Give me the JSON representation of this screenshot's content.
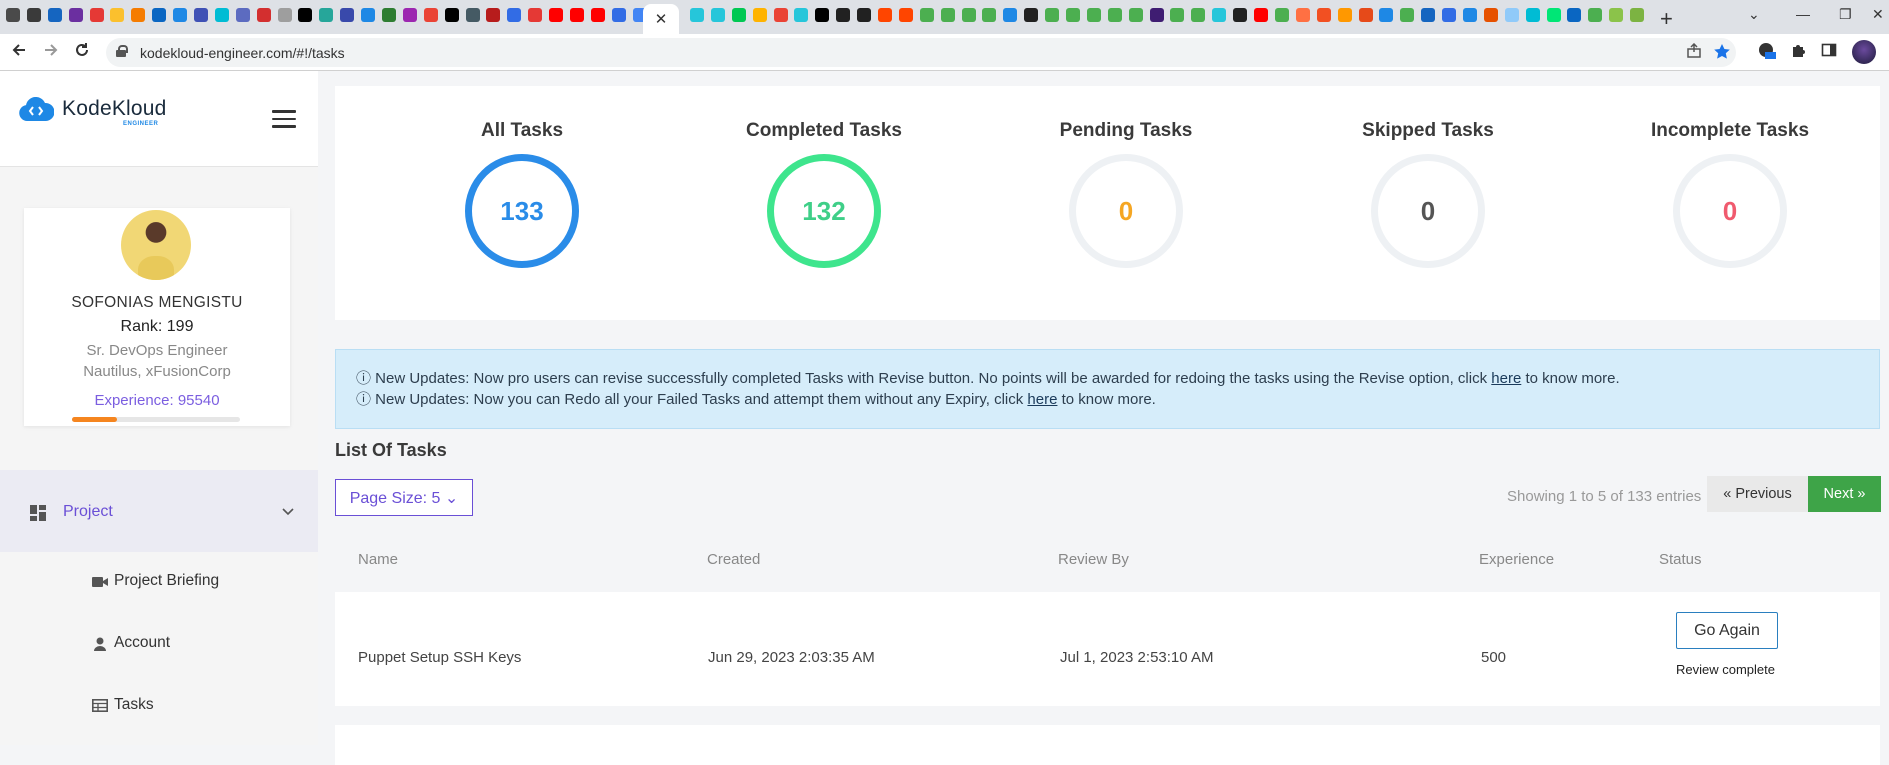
{
  "browser": {
    "url": "kodekloud-engineer.com/#!/tasks",
    "tab_close": "✕",
    "new_tab": "+",
    "favicon_colors": [
      "#4a4a4a",
      "#3a3a3a",
      "#1565c0",
      "#6b2fa0",
      "#e53935",
      "#fbc02d",
      "#f57c00",
      "#0a66c2",
      "#1e88e5",
      "#3f51b5",
      "#00bcd4",
      "#5c6bc0",
      "#d32f2f",
      "#9e9e9e",
      "#000000",
      "#26a69a",
      "#3949ab",
      "#1e88e5",
      "#2e7d32",
      "#9c27b0",
      "#ea4335",
      "#000000",
      "#455a64",
      "#b71c1c",
      "#326ce5",
      "#e53935",
      "#ff0000",
      "#ff0000",
      "#ff0000",
      "#326ce5",
      "#4285f4"
    ],
    "favicon_colors_right": [
      "#26c6da",
      "#26c6da",
      "#00c853",
      "#ffb300",
      "#ea4335",
      "#26c6da",
      "#000000",
      "#212121",
      "#212121",
      "#ff4500",
      "#ff4500",
      "#4caf50",
      "#4caf50",
      "#4caf50",
      "#4caf50",
      "#1e88e5",
      "#212121",
      "#4caf50",
      "#4caf50",
      "#4caf50",
      "#4caf50",
      "#4caf50",
      "#3f1d72",
      "#4caf50",
      "#4caf50",
      "#26c6da",
      "#212121",
      "#ff0000",
      "#4caf50",
      "#ff7043",
      "#f25022",
      "#ff9800",
      "#e64a19",
      "#1e88e5",
      "#4caf50",
      "#1565c0",
      "#326ce5",
      "#1e88e5",
      "#e65100",
      "#90caf9",
      "#00bcd4",
      "#00e676",
      "#0a66c2",
      "#4caf50",
      "#8bc34a",
      "#7cb342"
    ],
    "window_controls": [
      "⌄",
      "—",
      "❐",
      "✕"
    ]
  },
  "app": {
    "logo_text": "KodeKloud",
    "logo_sub": "ENGINEER"
  },
  "profile": {
    "name": "SOFONIAS MENGISTU",
    "rank": "Rank: 199",
    "title": "Sr. DevOps Engineer",
    "org": "Nautilus, xFusionCorp",
    "experience": "Experience: 95540",
    "experience_progress_fraction": 0.27
  },
  "sidebar": {
    "project_label": "Project",
    "items": [
      {
        "label": "Project Briefing",
        "icon": "video-camera-icon"
      },
      {
        "label": "Account",
        "icon": "user-icon"
      },
      {
        "label": "Tasks",
        "icon": "table-icon"
      }
    ]
  },
  "stats": [
    {
      "title": "All Tasks",
      "value": "133",
      "color": "#2a8ce8",
      "ring_color": "#2a8ce8",
      "filled": true
    },
    {
      "title": "Completed Tasks",
      "value": "132",
      "color": "#3fcf88",
      "ring_color": "#3ee58d",
      "filled": true
    },
    {
      "title": "Pending Tasks",
      "value": "0",
      "color": "#f5a623",
      "ring_color": "#eef1f4",
      "filled": false
    },
    {
      "title": "Skipped Tasks",
      "value": "0",
      "color": "#555555",
      "ring_color": "#eef1f4",
      "filled": false
    },
    {
      "title": "Incomplete Tasks",
      "value": "0",
      "color": "#f05a6e",
      "ring_color": "#eef1f4",
      "filled": false
    }
  ],
  "alerts": {
    "line1_text": "ⓘ New Updates: Now pro users can revise successfully completed Tasks with Revise button. No points will be awarded for redoing the tasks using the Revise option, click ",
    "line1_link": "here",
    "line1_end": " to know more.",
    "line2_text": "ⓘ New Updates: Now you can Redo all your Failed Tasks and attempt them without any Expiry, click ",
    "line2_link": "here",
    "line2_end": " to know more."
  },
  "tasks": {
    "heading": "List Of Tasks",
    "page_size": "Page Size: 5 ⌄",
    "showing": "Showing 1 to 5 of 133 entries",
    "prev_label": "« Previous",
    "next_label": "Next »",
    "columns": [
      "Name",
      "Created",
      "Review By",
      "Experience",
      "Status"
    ],
    "rows": [
      {
        "name": "Puppet Setup SSH Keys",
        "created": "Jun 29, 2023 2:03:35 AM",
        "review_by": "Jul 1, 2023 2:53:10 AM",
        "experience": "500",
        "action": "Go Again",
        "status": "Review complete"
      }
    ]
  }
}
